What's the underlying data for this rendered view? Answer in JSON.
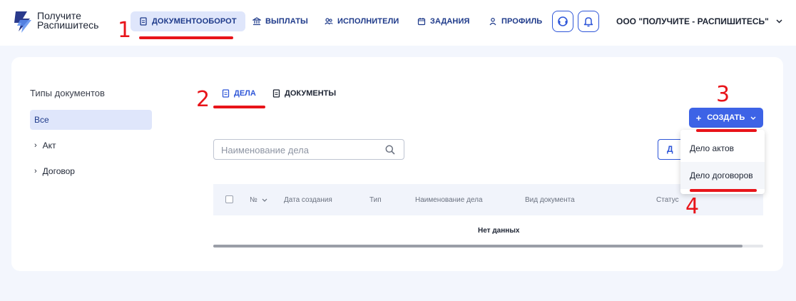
{
  "brand": {
    "line1": "Получите",
    "line2": "Распишитесь"
  },
  "nav": [
    {
      "label": "ДОКУМЕНТООБОРОТ",
      "active": true
    },
    {
      "label": "ВЫПЛАТЫ"
    },
    {
      "label": "ИСПОЛНИТЕЛИ"
    },
    {
      "label": "ЗАДАНИЯ"
    },
    {
      "label": "ПРОФИЛЬ"
    }
  ],
  "org": {
    "name": "ООО \"ПОЛУЧИТЕ - РАСПИШИТЕСЬ\""
  },
  "sidebar": {
    "title": "Типы документов",
    "items": [
      {
        "label": "Все"
      },
      {
        "label": "Акт"
      },
      {
        "label": "Договор"
      }
    ]
  },
  "tabs": [
    {
      "label": "ДЕЛА"
    },
    {
      "label": "ДОКУМЕНТЫ"
    }
  ],
  "search": {
    "placeholder": "Наименование дела",
    "value": ""
  },
  "partial_button": {
    "label": "Д"
  },
  "create_button": {
    "label": "СОЗДАТЬ",
    "icon": "+"
  },
  "dropdown": {
    "items": [
      {
        "label": "Дело актов"
      },
      {
        "label": "Дело договоров"
      }
    ]
  },
  "table": {
    "columns": [
      "№",
      "Дата создания",
      "Тип",
      "Наименование дела",
      "Вид документа",
      "Статус"
    ],
    "empty_text": "Нет данных"
  },
  "annotations": [
    "1",
    "2",
    "3",
    "4"
  ],
  "colors": {
    "accent": "#3d63e6",
    "annotation": "#e8141a",
    "nav_text": "#1e3a8a"
  }
}
